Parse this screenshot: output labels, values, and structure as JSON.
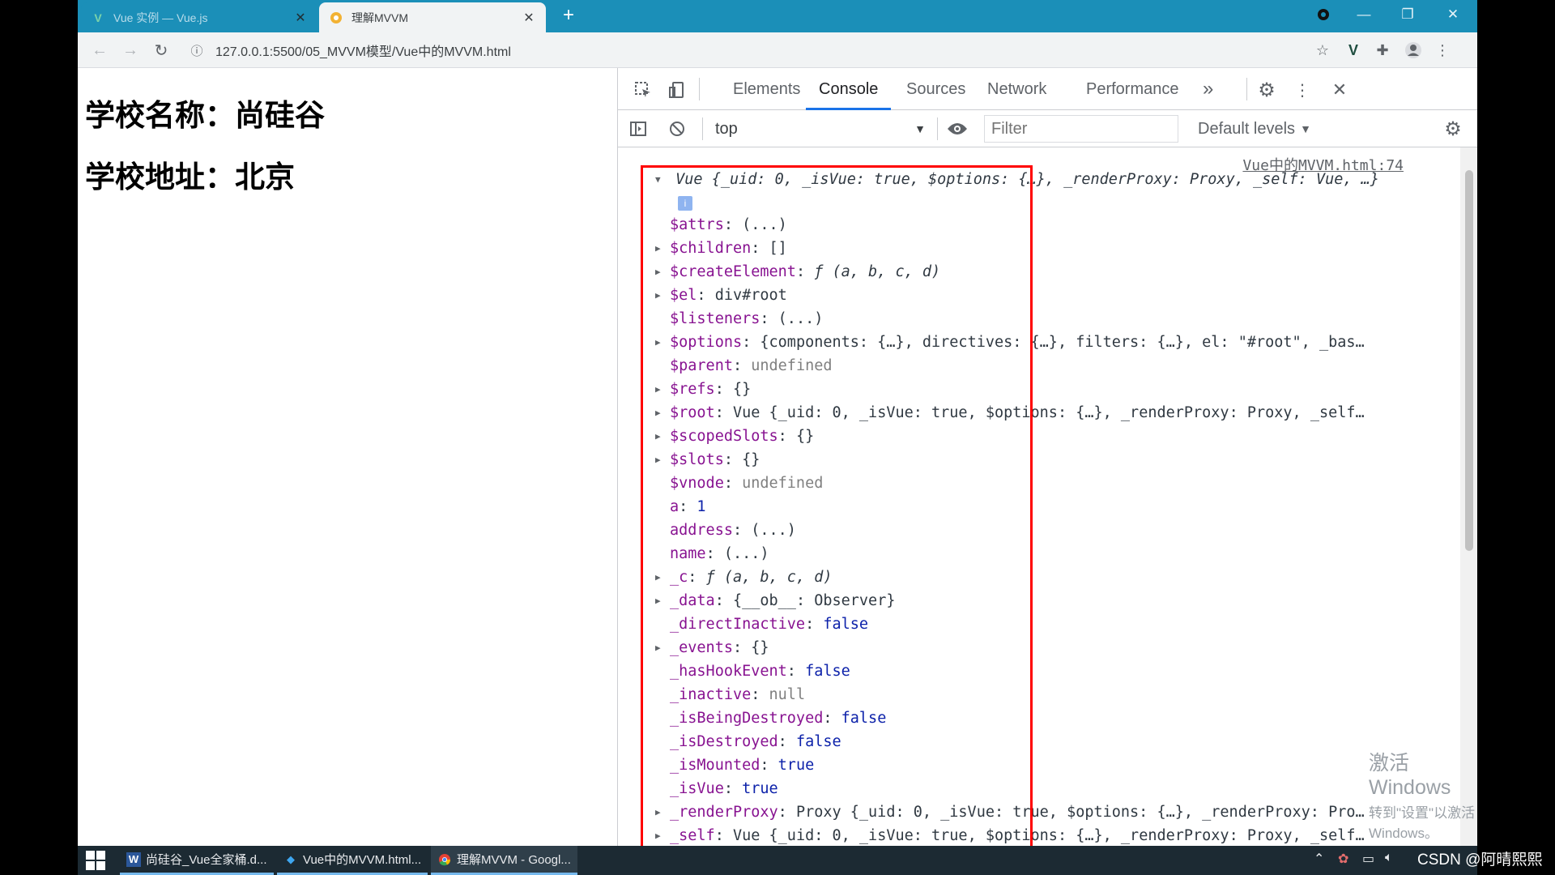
{
  "browser": {
    "tabs": [
      {
        "title": "Vue 实例 — Vue.js",
        "active": false
      },
      {
        "title": "理解MVVM",
        "active": true
      }
    ],
    "url": "127.0.0.1:5500/05_MVVM模型/Vue中的MVVM.html"
  },
  "page": {
    "school_name": "学校名称：尚硅谷",
    "school_address": "学校地址：北京"
  },
  "devtools": {
    "tabs": [
      "Elements",
      "Console",
      "Sources",
      "Network",
      "Performance"
    ],
    "more": "»",
    "active_tab": "Console",
    "context": "top",
    "filter_placeholder": "Filter",
    "levels": "Default levels",
    "source_link": "Vue中的MVVM.html:74"
  },
  "console": {
    "header": {
      "cls": "Vue ",
      "body": "{_uid: 0, _isVue: true, $options: {…}, _renderProxy: Proxy, _self: Vue, …}",
      "badge": "i"
    },
    "props": [
      {
        "key": "$attrs",
        "value": "(...)",
        "expandable": false
      },
      {
        "key": "$children",
        "value": "[]",
        "expandable": true
      },
      {
        "key": "$createElement",
        "value": "ƒ (a, b, c, d)",
        "expandable": true
      },
      {
        "key": "$el",
        "value": "div#root",
        "expandable": true
      },
      {
        "key": "$listeners",
        "value": "(...)",
        "expandable": false
      },
      {
        "key": "$options",
        "value": "{components: {…}, directives: {…}, filters: {…}, el: \"#root\", _bas…",
        "expandable": true
      },
      {
        "key": "$parent",
        "value": "undefined",
        "expandable": false
      },
      {
        "key": "$refs",
        "value": "{}",
        "expandable": true
      },
      {
        "key": "$root",
        "value": "Vue {_uid: 0, _isVue: true, $options: {…}, _renderProxy: Proxy, _self…",
        "expandable": true
      },
      {
        "key": "$scopedSlots",
        "value": "{}",
        "expandable": true
      },
      {
        "key": "$slots",
        "value": "{}",
        "expandable": true
      },
      {
        "key": "$vnode",
        "value": "undefined",
        "expandable": false
      },
      {
        "key": "a",
        "value": "1",
        "expandable": false
      },
      {
        "key": "address",
        "value": "(...)",
        "expandable": false
      },
      {
        "key": "name",
        "value": "(...)",
        "expandable": false
      },
      {
        "key": "_c",
        "value": "ƒ (a, b, c, d)",
        "expandable": true
      },
      {
        "key": "_data",
        "value": "{__ob__: Observer}",
        "expandable": true
      },
      {
        "key": "_directInactive",
        "value": "false",
        "expandable": false
      },
      {
        "key": "_events",
        "value": "{}",
        "expandable": true
      },
      {
        "key": "_hasHookEvent",
        "value": "false",
        "expandable": false
      },
      {
        "key": "_inactive",
        "value": "null",
        "expandable": false
      },
      {
        "key": "_isBeingDestroyed",
        "value": "false",
        "expandable": false
      },
      {
        "key": "_isDestroyed",
        "value": "false",
        "expandable": false
      },
      {
        "key": "_isMounted",
        "value": "true",
        "expandable": false
      },
      {
        "key": "_isVue",
        "value": "true",
        "expandable": false
      },
      {
        "key": "_renderProxy",
        "value": "Proxy {_uid: 0, _isVue: true, $options: {…}, _renderProxy: Pro…",
        "expandable": true
      },
      {
        "key": "_self",
        "value": "Vue {_uid: 0, _isVue: true, $options: {…}, _renderProxy: Proxy, _self…",
        "expandable": true
      }
    ]
  },
  "watermark": {
    "line1": "激活 Windows",
    "line2": "转到\"设置\"以激活 Windows。"
  },
  "taskbar": {
    "apps": [
      "尚硅谷_Vue全家桶.d...",
      "Vue中的MVVM.html...",
      "理解MVVM - Googl..."
    ]
  },
  "overlay": {
    "credit": "CSDN @阿晴熙熙"
  },
  "colors": {
    "tabstrip": "#1b8fb8",
    "highlight_box": "#ff0000",
    "devtools_accent": "#1a73e8"
  }
}
